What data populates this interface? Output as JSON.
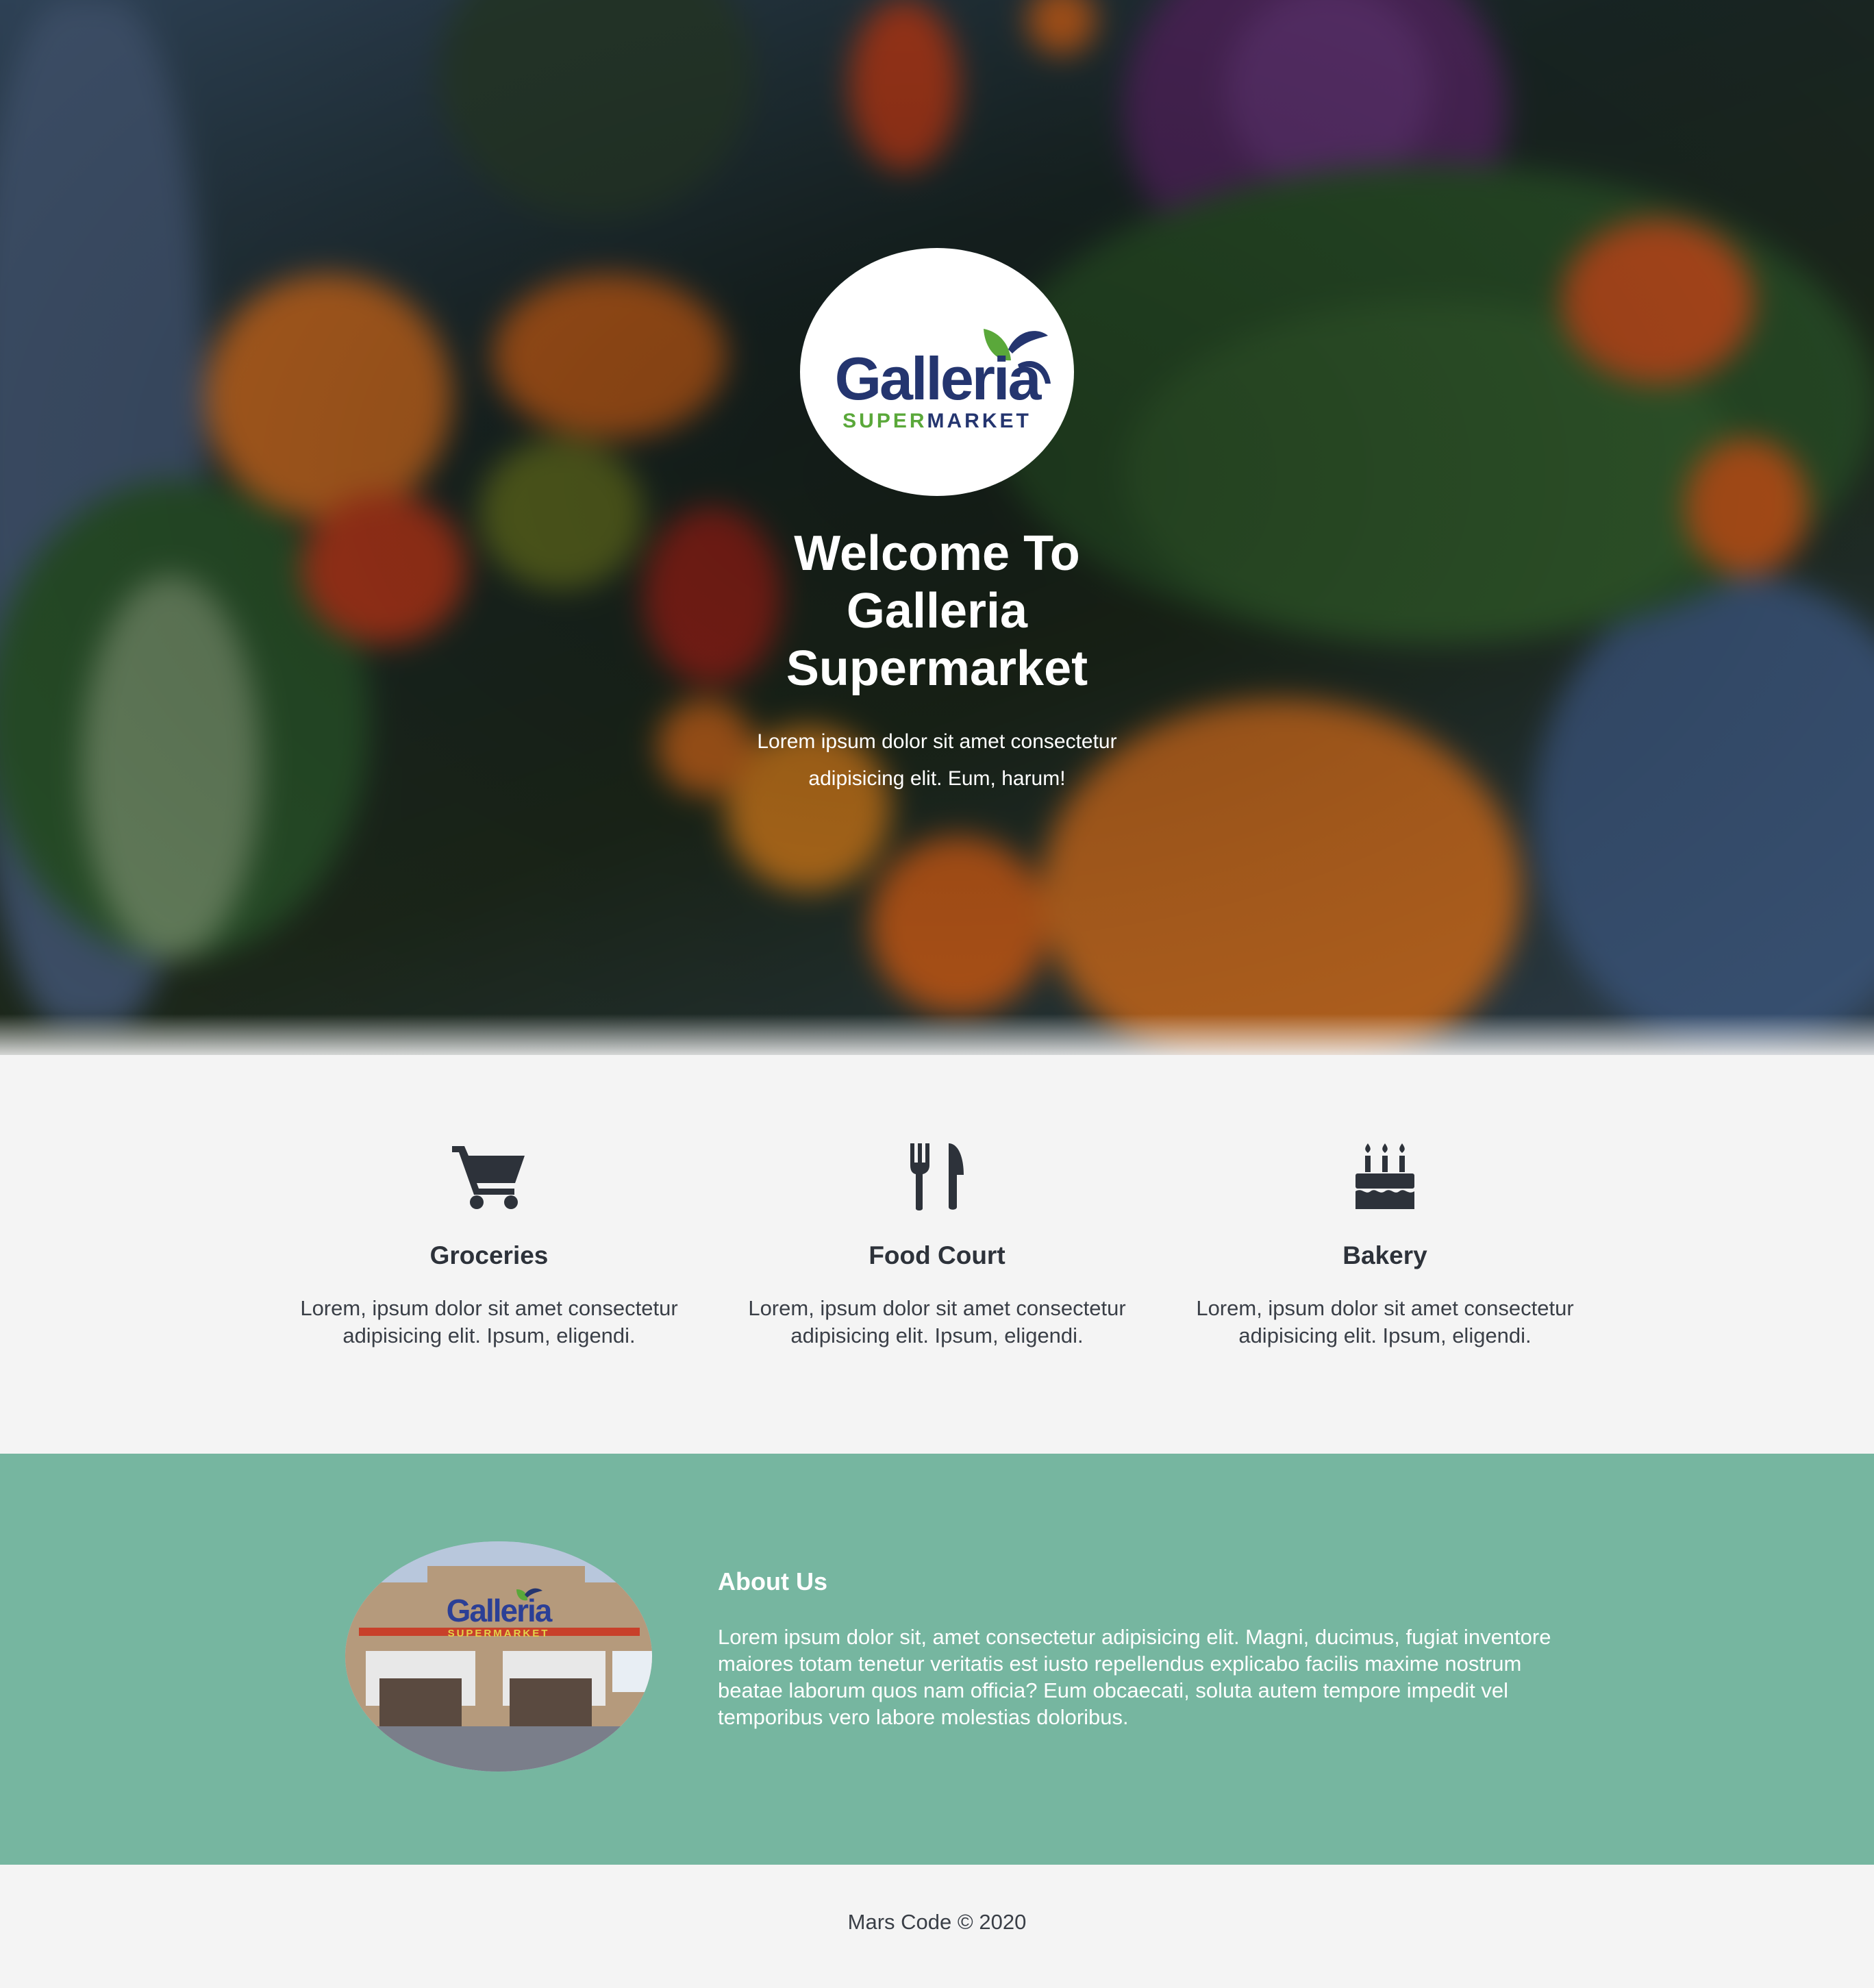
{
  "hero": {
    "logo": {
      "word": "Galleria",
      "sub_super": "SUPER",
      "sub_market": "MARKET"
    },
    "title": "Welcome To Galleria Supermarket",
    "subtitle": "Lorem ipsum dolor sit amet consectetur adipisicing elit. Eum, harum!"
  },
  "features": [
    {
      "icon": "shopping-cart-icon",
      "title": "Groceries",
      "text": "Lorem, ipsum dolor sit amet consectetur adipisicing elit. Ipsum, eligendi."
    },
    {
      "icon": "utensils-icon",
      "title": "Food Court",
      "text": "Lorem, ipsum dolor sit amet consectetur adipisicing elit. Ipsum, eligendi."
    },
    {
      "icon": "birthday-cake-icon",
      "title": "Bakery",
      "text": "Lorem, ipsum dolor sit amet consectetur adipisicing elit. Ipsum, eligendi."
    }
  ],
  "about": {
    "title": "About Us",
    "text": "Lorem ipsum dolor sit, amet consectetur adipisicing elit. Magni, ducimus, fugiat inventore maiores totam tenetur veritatis est iusto repellendus explicabo facilis maxime nostrum beatae laborum quos nam officia? Eum obcaecati, soluta autem tempore impedit vel temporibus vero labore molestias doloribus.",
    "store_sign": "Galleria",
    "store_sign_sub": "SUPERMARKET"
  },
  "footer": {
    "text": "Mars Code © 2020"
  },
  "colors": {
    "about_bg": "#76b6a0",
    "page_bg": "#f4f4f4",
    "icon_dark": "#2d323a",
    "logo_navy": "#24356f",
    "logo_green": "#5aa83a"
  }
}
